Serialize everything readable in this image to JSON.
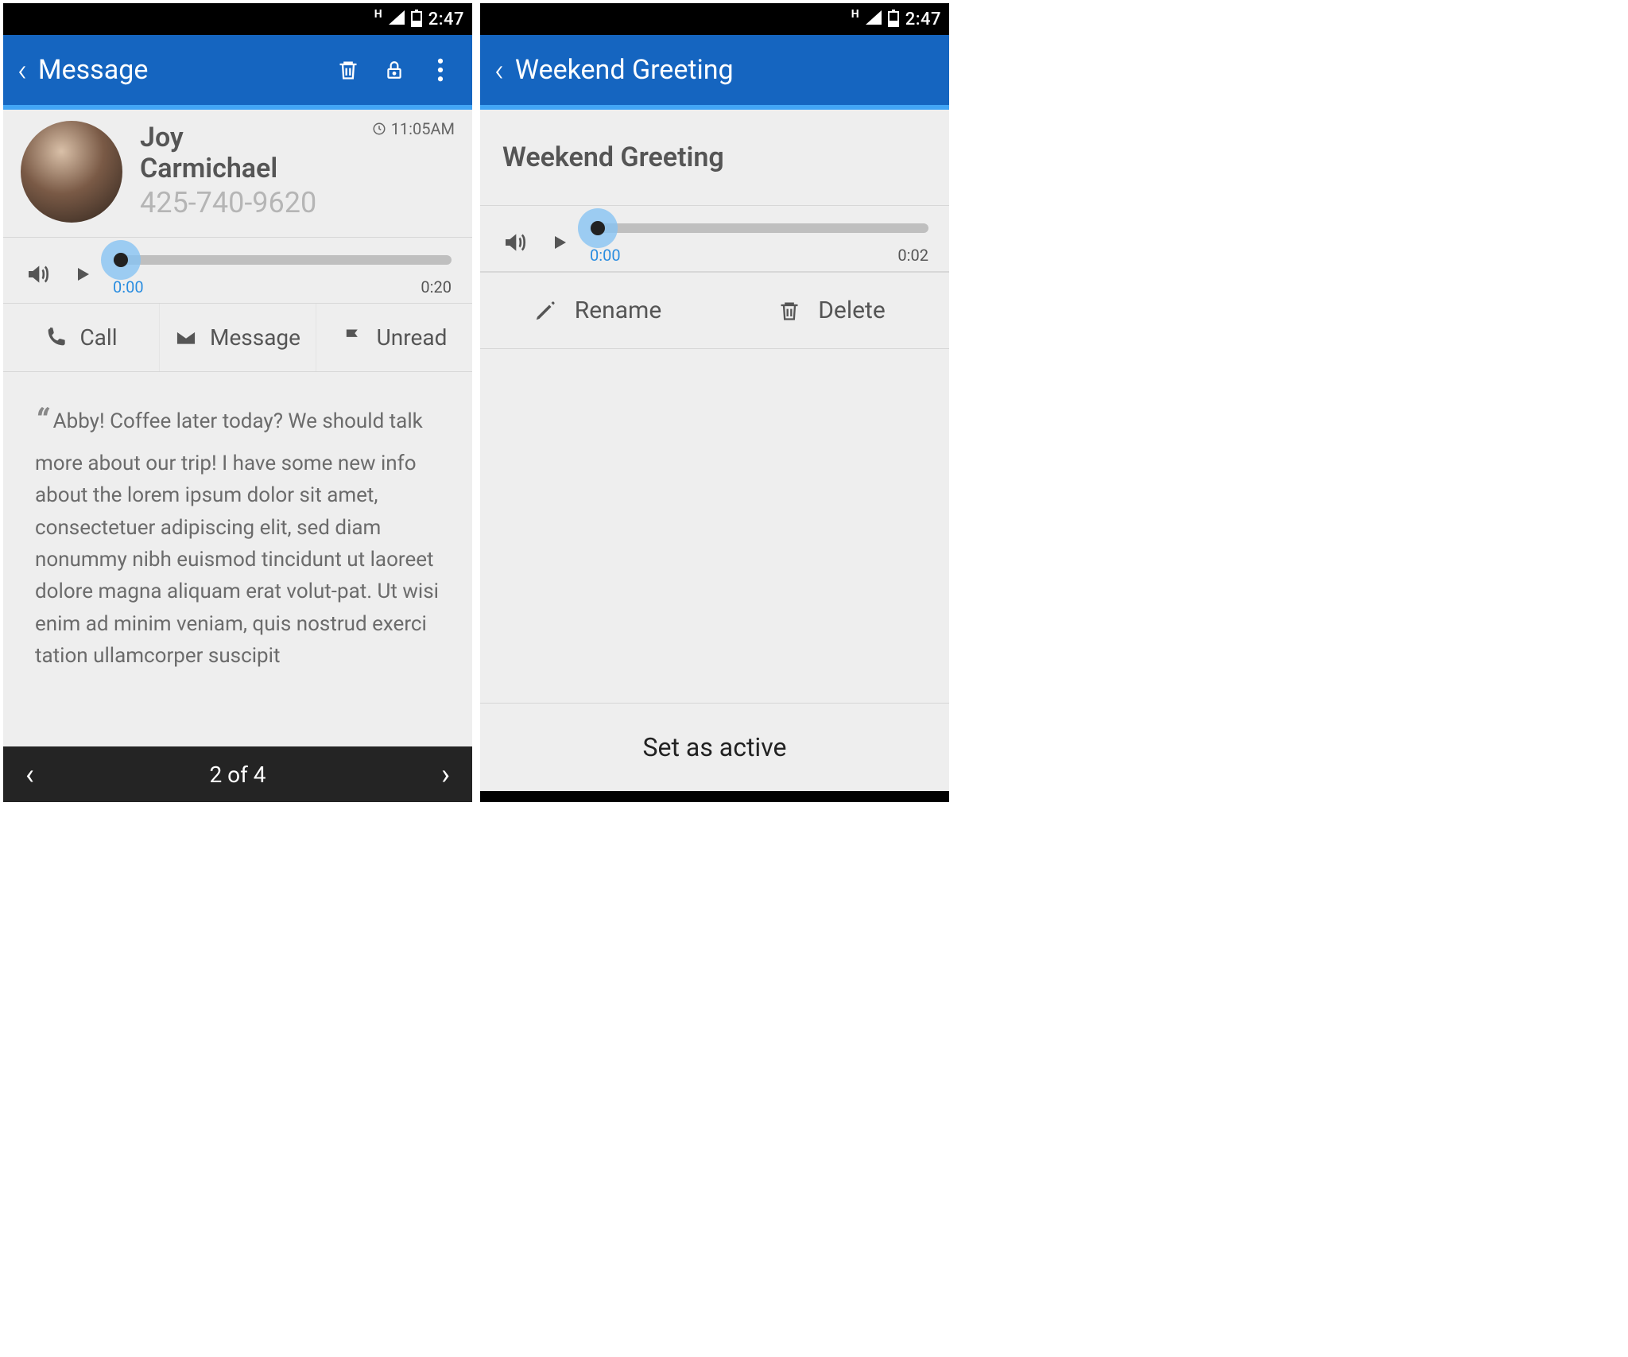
{
  "status": {
    "time": "2:47",
    "network_letter": "H"
  },
  "left": {
    "appbar": {
      "title": "Message"
    },
    "contact": {
      "first_name": "Joy",
      "last_name": "Carmichael",
      "phone": "425-740-9620",
      "time": "11:05AM"
    },
    "player": {
      "current": "0:00",
      "duration": "0:20"
    },
    "actions": {
      "call": "Call",
      "message": "Message",
      "unread": "Unread"
    },
    "transcript": "Abby! Coffee later today? We should talk more about our trip! I have some new info about the lorem ipsum dolor sit amet, consectetuer adipiscing elit, sed diam nonummy nibh euismod tincidunt ut laoreet dolore magna aliquam erat volut-pat. Ut wisi enim ad minim veniam, quis nostrud exerci tation ullamcorper suscipit",
    "pager": {
      "label": "2 of 4"
    }
  },
  "right": {
    "appbar": {
      "title": "Weekend Greeting"
    },
    "greeting_name": "Weekend Greeting",
    "player": {
      "current": "0:00",
      "duration": "0:02"
    },
    "actions": {
      "rename": "Rename",
      "delete": "Delete"
    },
    "set_active": "Set as active"
  }
}
